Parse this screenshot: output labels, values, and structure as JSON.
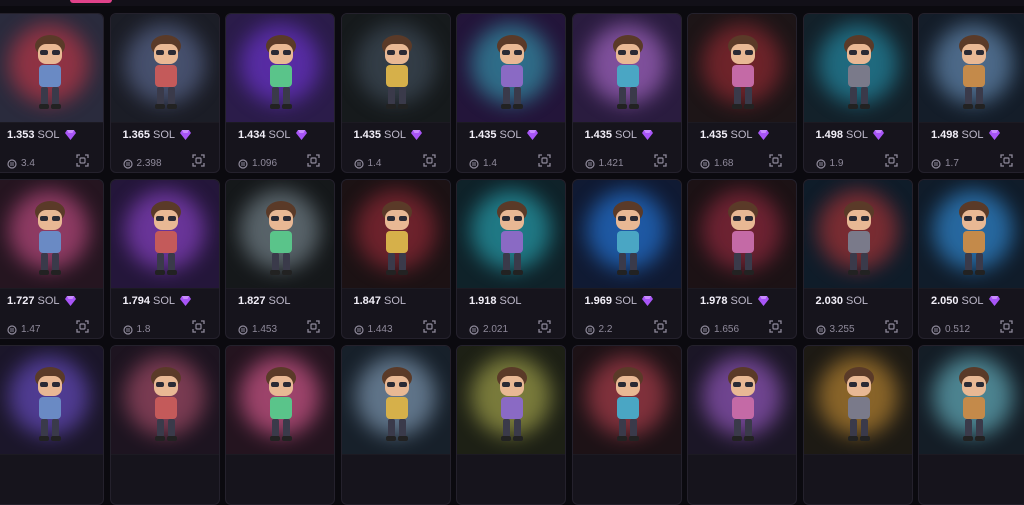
{
  "currency": "SOL",
  "colors": {
    "gem": "#a855f7",
    "muted": "#8f8a9b",
    "card": "#16141c"
  },
  "icons": {
    "price": "diamond-icon",
    "stat": "transfer-icon",
    "action": "scan-icon"
  },
  "cards": [
    {
      "price": "1.353",
      "stat": "3.4",
      "gem": true,
      "bg": "#2a2b3d",
      "glow": "#e23a4a"
    },
    {
      "price": "1.365",
      "stat": "2.398",
      "gem": true,
      "bg": "#1b1d26",
      "glow": "#6a7aa8"
    },
    {
      "price": "1.434",
      "stat": "1.096",
      "gem": true,
      "bg": "#2b1c4a",
      "glow": "#7c3aed"
    },
    {
      "price": "1.435",
      "stat": "1.4",
      "gem": true,
      "bg": "#161a1c",
      "glow": "#4b5a6a"
    },
    {
      "price": "1.435",
      "stat": "1.4",
      "gem": true,
      "bg": "#23153a",
      "glow": "#3ab4c8"
    },
    {
      "price": "1.435",
      "stat": "1.421",
      "gem": true,
      "bg": "#2a1c3f",
      "glow": "#c47ae6"
    },
    {
      "price": "1.435",
      "stat": "1.68",
      "gem": true,
      "bg": "#1d1517",
      "glow": "#b0303a"
    },
    {
      "price": "1.498",
      "stat": "1.9",
      "gem": true,
      "bg": "#13212a",
      "glow": "#2aa6c4"
    },
    {
      "price": "1.498",
      "stat": "1.7",
      "gem": true,
      "bg": "#141d29",
      "glow": "#7aa7d6"
    },
    {
      "price": "1.727",
      "stat": "1.47",
      "gem": true,
      "bg": "#251520",
      "glow": "#e45a9a"
    },
    {
      "price": "1.794",
      "stat": "1.8",
      "gem": true,
      "bg": "#24163a",
      "glow": "#a24ee6"
    },
    {
      "price": "1.827",
      "stat": "1.453",
      "gem": false,
      "bg": "#15181a",
      "glow": "#8fa0aa"
    },
    {
      "price": "1.847",
      "stat": "1.443",
      "gem": false,
      "bg": "#1c1214",
      "glow": "#b03040"
    },
    {
      "price": "1.918",
      "stat": "2.021",
      "gem": false,
      "bg": "#0f2229",
      "glow": "#2ec0d0"
    },
    {
      "price": "1.969",
      "stat": "2.2",
      "gem": true,
      "bg": "#101a33",
      "glow": "#2a8cff"
    },
    {
      "price": "1.978",
      "stat": "1.656",
      "gem": true,
      "bg": "#1c1215",
      "glow": "#b0304a"
    },
    {
      "price": "2.030",
      "stat": "3.255",
      "gem": false,
      "bg": "#0f1c29",
      "glow": "#d03a3a"
    },
    {
      "price": "2.050",
      "stat": "0.512",
      "gem": true,
      "bg": "#101c2a",
      "glow": "#3aa6ff"
    },
    {
      "price": "",
      "stat": "",
      "gem": false,
      "bg": "#1b162a",
      "glow": "#7a5ae6"
    },
    {
      "price": "",
      "stat": "",
      "gem": false,
      "bg": "#1d1420",
      "glow": "#c45a7a"
    },
    {
      "price": "",
      "stat": "",
      "gem": false,
      "bg": "#24141f",
      "glow": "#ff6aa8"
    },
    {
      "price": "",
      "stat": "",
      "gem": false,
      "bg": "#17202a",
      "glow": "#9ab8d6"
    },
    {
      "price": "",
      "stat": "",
      "gem": false,
      "bg": "#1d2015",
      "glow": "#c4c45a"
    },
    {
      "price": "",
      "stat": "",
      "gem": false,
      "bg": "#1d1216",
      "glow": "#d04a5a"
    },
    {
      "price": "",
      "stat": "",
      "gem": false,
      "bg": "#1b1626",
      "glow": "#b46ae6"
    },
    {
      "price": "",
      "stat": "",
      "gem": false,
      "bg": "#1d1a14",
      "glow": "#e0a03a"
    },
    {
      "price": "",
      "stat": "",
      "gem": false,
      "bg": "#141d26",
      "glow": "#7ad6e6"
    }
  ]
}
